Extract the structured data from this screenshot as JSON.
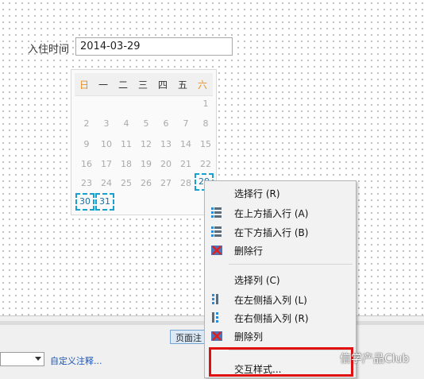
{
  "form": {
    "checkin_label": "入住时间",
    "date_value": "2014-03-29"
  },
  "calendar": {
    "weekdays": [
      "日",
      "一",
      "二",
      "三",
      "四",
      "五",
      "六"
    ],
    "days": [
      "1",
      "2",
      "3",
      "4",
      "5",
      "6",
      "7",
      "8",
      "9",
      "10",
      "11",
      "12",
      "13",
      "14",
      "15",
      "16",
      "17",
      "18",
      "19",
      "20",
      "21",
      "22",
      "23",
      "24",
      "25",
      "26",
      "27",
      "28",
      "29",
      "30",
      "31"
    ],
    "selected_day": "29",
    "accent_color": "#e88f24",
    "selection_color": "#1aa0cf"
  },
  "context_menu": {
    "items": [
      {
        "label": "选择行 (R)",
        "icon": ""
      },
      {
        "label": "在上方插入行 (A)",
        "icon": "insert-row-above-icon"
      },
      {
        "label": "在下方插入行 (B)",
        "icon": "insert-row-below-icon"
      },
      {
        "label": "删除行",
        "icon": "delete-row-icon"
      },
      {
        "label": "选择列 (C)",
        "icon": ""
      },
      {
        "label": "在左侧插入列 (L)",
        "icon": "insert-column-left-icon"
      },
      {
        "label": "在右侧插入列 (R)",
        "icon": "insert-column-right-icon"
      },
      {
        "label": "删除列",
        "icon": "delete-column-icon"
      },
      {
        "label": "交互样式...",
        "icon": ""
      }
    ]
  },
  "bottom_panel": {
    "page_note_tab": "页面注",
    "custom_note_link": "自定义注释..."
  },
  "watermark": "信学产品Club",
  "highlight_color": "#e01010"
}
